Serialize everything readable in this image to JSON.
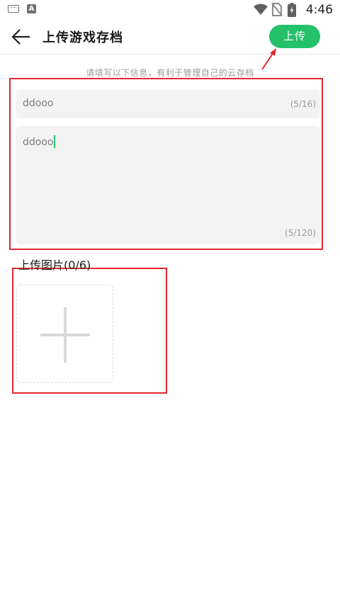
{
  "status_bar": {
    "time": "4:46",
    "notification_icon_letter": "A",
    "icons": [
      "keyboard-icon",
      "a-app-icon",
      "wifi-icon",
      "no-sim-icon",
      "battery-icon"
    ]
  },
  "header": {
    "back_icon": "arrow-left-icon",
    "title": "上传游戏存档",
    "upload_label": "上传"
  },
  "form": {
    "hint": "请填写以下信息，有利于管理自己的云存档",
    "title_field": {
      "value": "ddooo",
      "counter": "(5/16)"
    },
    "description_field": {
      "value": "ddooo",
      "counter": "(5/120)"
    },
    "photos": {
      "label": "上传图片(0/6)",
      "add_icon": "plus-icon"
    }
  },
  "colors": {
    "accent": "#24c06a",
    "annotation": "#e5282d",
    "input_background": "#f3f3f3"
  }
}
